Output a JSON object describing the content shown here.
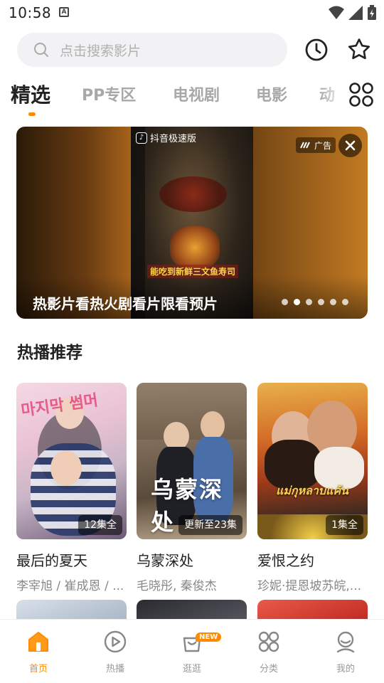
{
  "status_bar": {
    "time": "10:58"
  },
  "search": {
    "placeholder": "点击搜索影片"
  },
  "header_icons": [
    "history-icon",
    "favorite-icon"
  ],
  "tabs": [
    {
      "label": "精选",
      "active": true
    },
    {
      "label": "PP专区",
      "active": false
    },
    {
      "label": "电视剧",
      "active": false
    },
    {
      "label": "电影",
      "active": false
    },
    {
      "label": "动",
      "active": false
    }
  ],
  "banner": {
    "app_tag": "抖音极速版",
    "inner_caption": "能吃到新鲜三文鱼寿司",
    "ad_label": "广告",
    "title": "热影片看热火剧看片限看预片",
    "dots": 6,
    "active_dot": 1
  },
  "section": {
    "title": "热播推荐"
  },
  "cards": [
    {
      "name": "最后的夏天",
      "cast": "李宰旭 / 崔成恩 / ...",
      "badge": "12集全",
      "poster_text": "마지막 썸머"
    },
    {
      "name": "乌蒙深处",
      "cast": "毛晓彤, 秦俊杰",
      "badge": "更新至23集",
      "poster_text": "乌蒙深处"
    },
    {
      "name": "爱恨之约",
      "cast": "珍妮·提恩坡苏皖,...",
      "badge": "1集全",
      "poster_text": "แม่กุหลาบแค้น"
    }
  ],
  "bottom_nav": [
    {
      "label": "首页",
      "icon": "home-icon",
      "active": true
    },
    {
      "label": "热播",
      "icon": "play-icon",
      "active": false
    },
    {
      "label": "逛逛",
      "icon": "bag-icon",
      "active": false,
      "badge": "NEW"
    },
    {
      "label": "分类",
      "icon": "grid-icon",
      "active": false
    },
    {
      "label": "我的",
      "icon": "profile-icon",
      "active": false
    }
  ],
  "colors": {
    "accent": "#ff8a00",
    "text": "#222222",
    "muted": "#999999"
  }
}
